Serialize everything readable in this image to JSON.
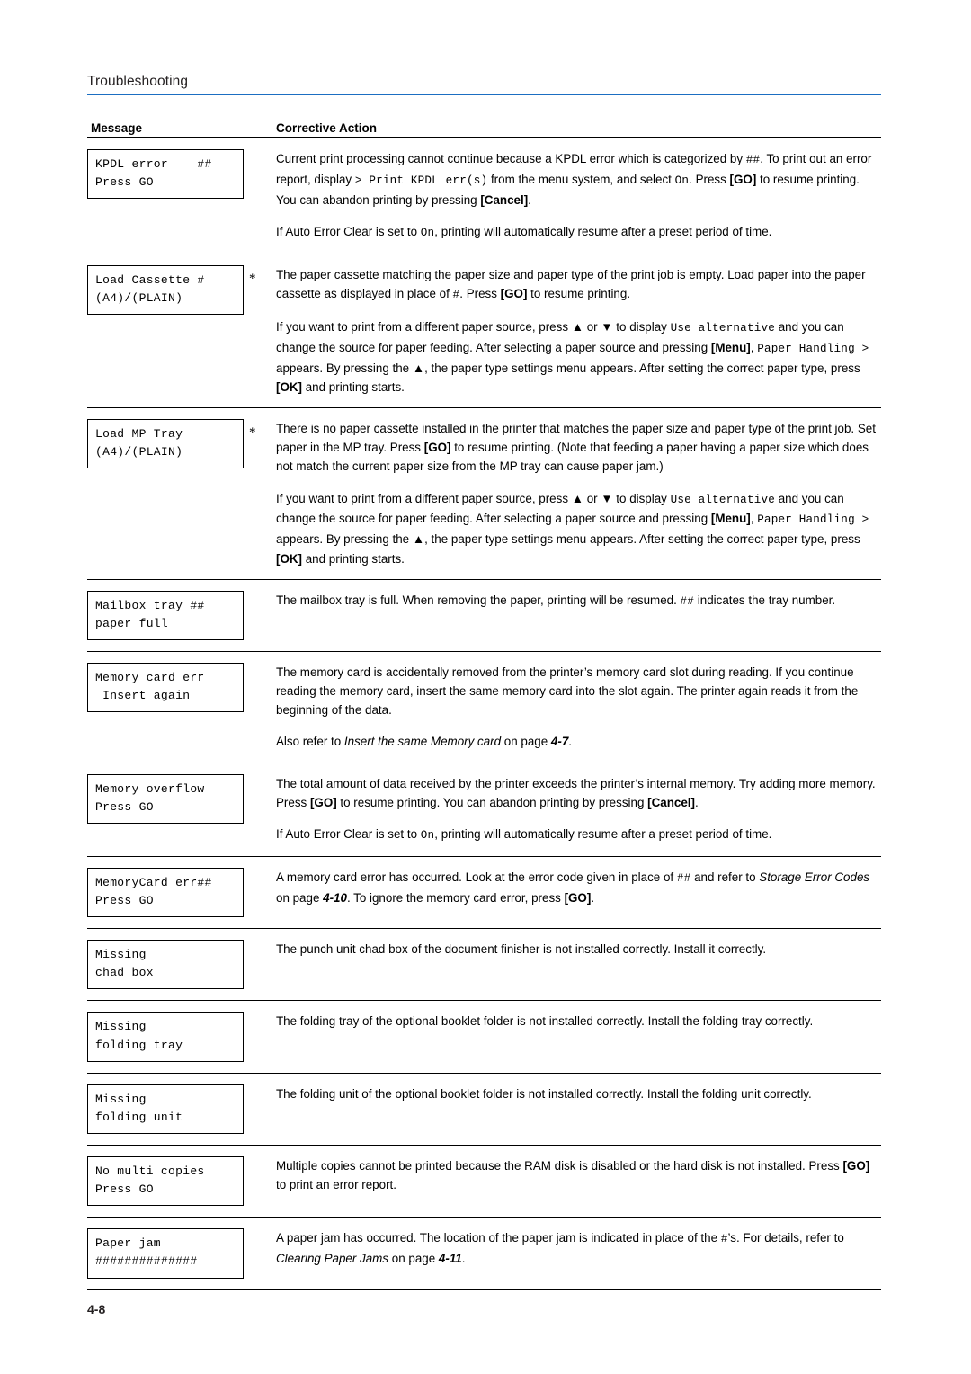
{
  "header": {
    "title": "Troubleshooting",
    "rule_color": "#1b6ec2"
  },
  "table": {
    "columns": [
      "Message",
      "Corrective Action"
    ],
    "rows": [
      {
        "message": "KPDL error    ##\nPress GO",
        "star": "",
        "paragraphs": [
          "Current print processing cannot continue because a KPDL error which is categorized by ##. To print out an error report, display > Print KPDL err(s) from the menu system, and select On. Press [GO] to resume printing. You can abandon printing by pressing [Cancel].",
          "If Auto Error Clear is set to On, printing will automatically resume after a preset period of time."
        ]
      },
      {
        "message": "Load Cassette #\n(A4)/(PLAIN)",
        "star": "*",
        "paragraphs": [
          "The paper cassette matching the paper size and paper type of the print job is empty. Load paper into the paper cassette as displayed in place of #. Press [GO] to resume printing.",
          "If you want to print from a different paper source, press ▲ or ▼ to display Use alternative and you can change the source for paper feeding. After selecting a paper source and pressing [Menu], Paper Handling > appears. By pressing the ▲, the paper type settings menu appears. After setting the correct paper type, press [OK] and printing starts."
        ]
      },
      {
        "message": "Load MP Tray\n(A4)/(PLAIN)",
        "star": "*",
        "paragraphs": [
          "There is no paper cassette installed in the printer that matches the paper size and paper type of the print job. Set paper in the MP tray. Press [GO] to resume printing. (Note that feeding a paper having a paper size which does not match the current paper size from the MP tray can cause paper jam.)",
          "If you want to print from a different paper source, press ▲ or ▼ to display Use alternative and you can change the source for paper feeding. After selecting a paper source and pressing [Menu], Paper Handling > appears. By pressing the ▲, the paper type settings menu appears. After setting the correct paper type, press [OK] and printing starts."
        ]
      },
      {
        "message": "Mailbox tray ##\npaper full",
        "star": "",
        "paragraphs": [
          "The mailbox tray is full. When removing the paper, printing will be resumed. ## indicates the tray number."
        ]
      },
      {
        "message": "Memory card err\n Insert again",
        "star": "",
        "paragraphs": [
          "The memory card is accidentally removed from the printer’s memory card slot during reading. If you continue reading the memory card, insert the same memory card into the slot again. The printer again reads it from the beginning of the data.",
          "Also refer to Insert the same Memory card on page 4-7."
        ]
      },
      {
        "message": "Memory overflow\nPress GO",
        "star": "",
        "paragraphs": [
          "The total amount of data received by the printer exceeds the printer’s internal memory. Try adding more memory. Press [GO] to resume printing. You can abandon printing by pressing [Cancel].",
          "If Auto Error Clear is set to On, printing will automatically resume after a preset period of time."
        ]
      },
      {
        "message": "MemoryCard err##\nPress GO",
        "star": "",
        "paragraphs": [
          "A memory card error has occurred. Look at the error code given in place of ## and refer to Storage Error Codes on page 4-10. To ignore the memory card error, press [GO]."
        ]
      },
      {
        "message": "Missing\nchad box",
        "star": "",
        "paragraphs": [
          "The punch unit chad box of the document finisher is not installed correctly. Install it correctly."
        ]
      },
      {
        "message": "Missing\nfolding tray",
        "star": "",
        "paragraphs": [
          "The folding tray of the optional booklet folder is not installed correctly. Install the folding tray correctly."
        ]
      },
      {
        "message": "Missing\nfolding unit",
        "star": "",
        "paragraphs": [
          "The folding unit of the optional booklet folder is not installed correctly. Install the folding unit correctly."
        ]
      },
      {
        "message": "No multi copies\nPress GO",
        "star": "",
        "paragraphs": [
          "Multiple copies cannot be printed because the RAM disk is disabled or the hard disk is not installed. Press [GO] to print an error report."
        ]
      },
      {
        "message": "Paper jam\n##############",
        "star": "",
        "paragraphs": [
          "A paper jam has occurred. The location of the paper jam is indicated in place of the #’s. For details, refer to Clearing Paper Jams on page 4-11."
        ]
      }
    ]
  },
  "footer": {
    "page_number": "4-8"
  }
}
